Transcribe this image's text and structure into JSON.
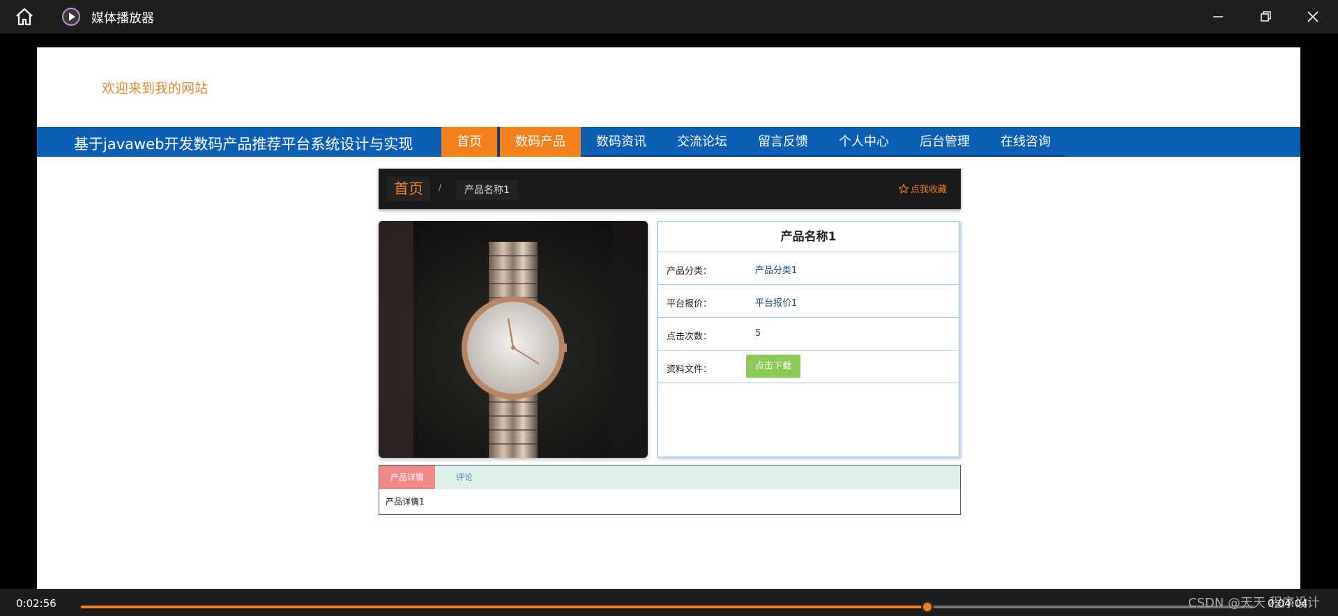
{
  "window": {
    "title": "媒体播放器"
  },
  "site": {
    "welcome": "欢迎来到我的网站",
    "title": "基于javaweb开发数码产品推荐平台系统设计与实现",
    "nav": [
      "首页",
      "数码产品",
      "数码资讯",
      "交流论坛",
      "留言反馈",
      "个人中心",
      "后台管理",
      "在线咨询"
    ],
    "nav_active": "数码产品",
    "accent": "#f2811d",
    "nav_bg": "#0a5fb4"
  },
  "breadcrumb": {
    "home": "首页",
    "sep": "/",
    "current": "产品名称1",
    "favorite": "点我收藏"
  },
  "product": {
    "name": "产品名称1",
    "rows": [
      {
        "label": "产品分类：",
        "value": "产品分类1"
      },
      {
        "label": "平台报价：",
        "value": "平台报价1"
      },
      {
        "label": "点击次数：",
        "value": "5"
      }
    ],
    "file_label": "资料文件：",
    "download_label": "点击下载"
  },
  "tabs": {
    "active": "产品详情",
    "other": "评论",
    "content": "产品详情1"
  },
  "player": {
    "current_time": "0:02:56",
    "total_time": "0:04:04",
    "progress": 0.7213,
    "watermark": "CSDN @天天 程序设计"
  }
}
